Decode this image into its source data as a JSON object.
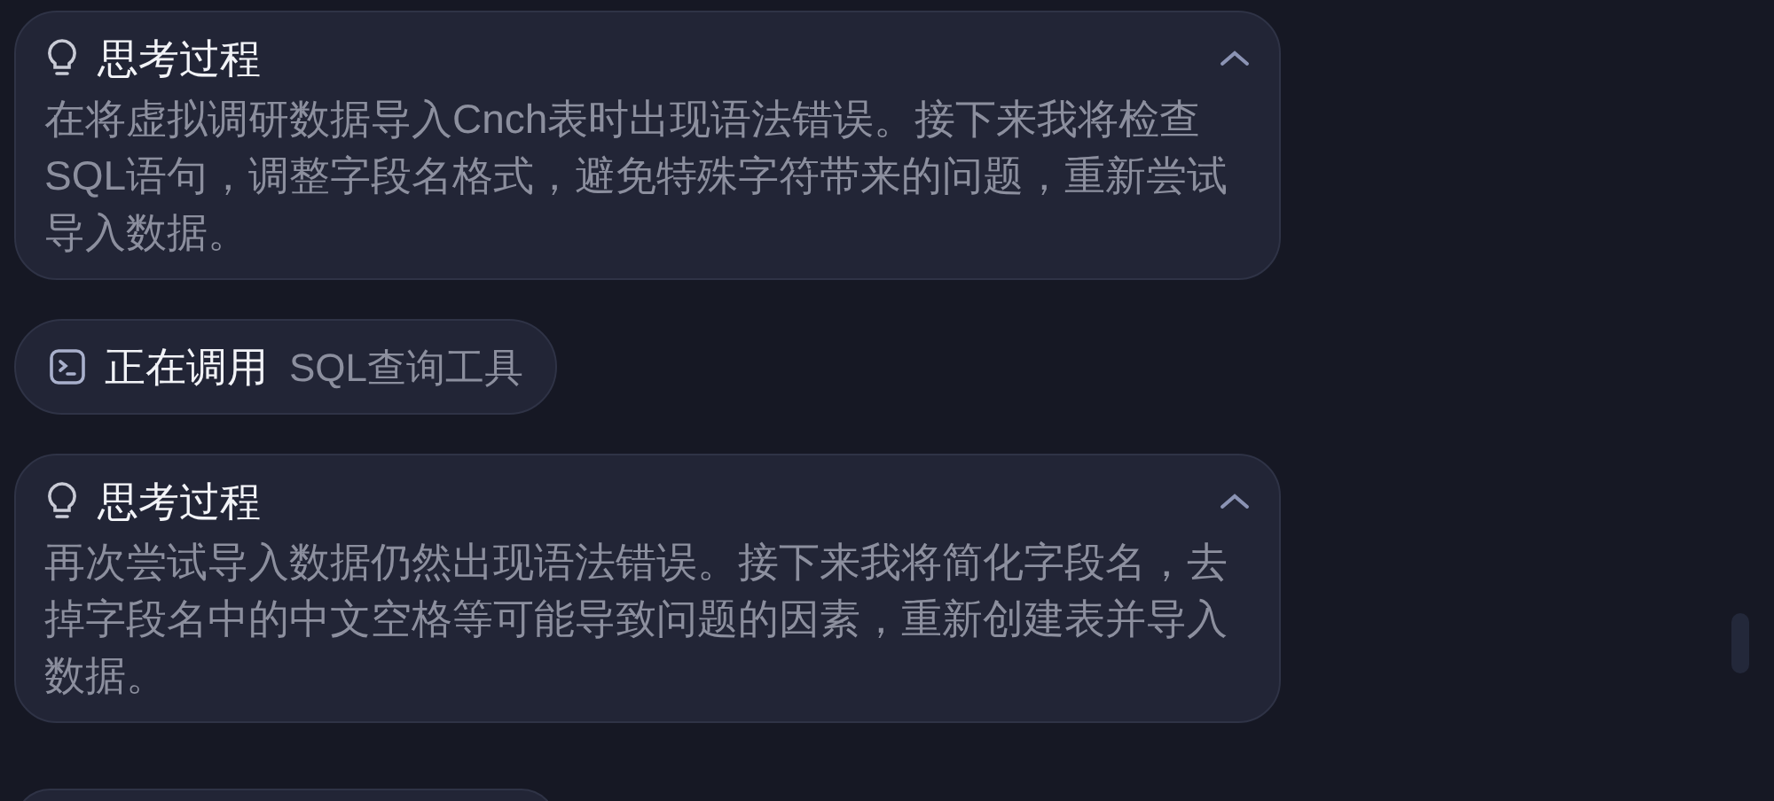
{
  "steps": [
    {
      "kind": "thinking",
      "title": "思考过程",
      "expanded": true,
      "text": "在将虚拟调研数据导入Cnch表时出现语法错误。接下来我将检查SQL语句，调整字段名格式，避免特殊字符带来的问题，重新尝试导入数据。"
    },
    {
      "kind": "tool_call",
      "status": "正在调用",
      "tool": "SQL查询工具"
    },
    {
      "kind": "thinking",
      "title": "思考过程",
      "expanded": true,
      "text": "再次尝试导入数据仍然出现语法错误。接下来我将简化字段名，去掉字段名中的中文空格等可能导致问题的因素，重新创建表并导入数据。"
    }
  ]
}
